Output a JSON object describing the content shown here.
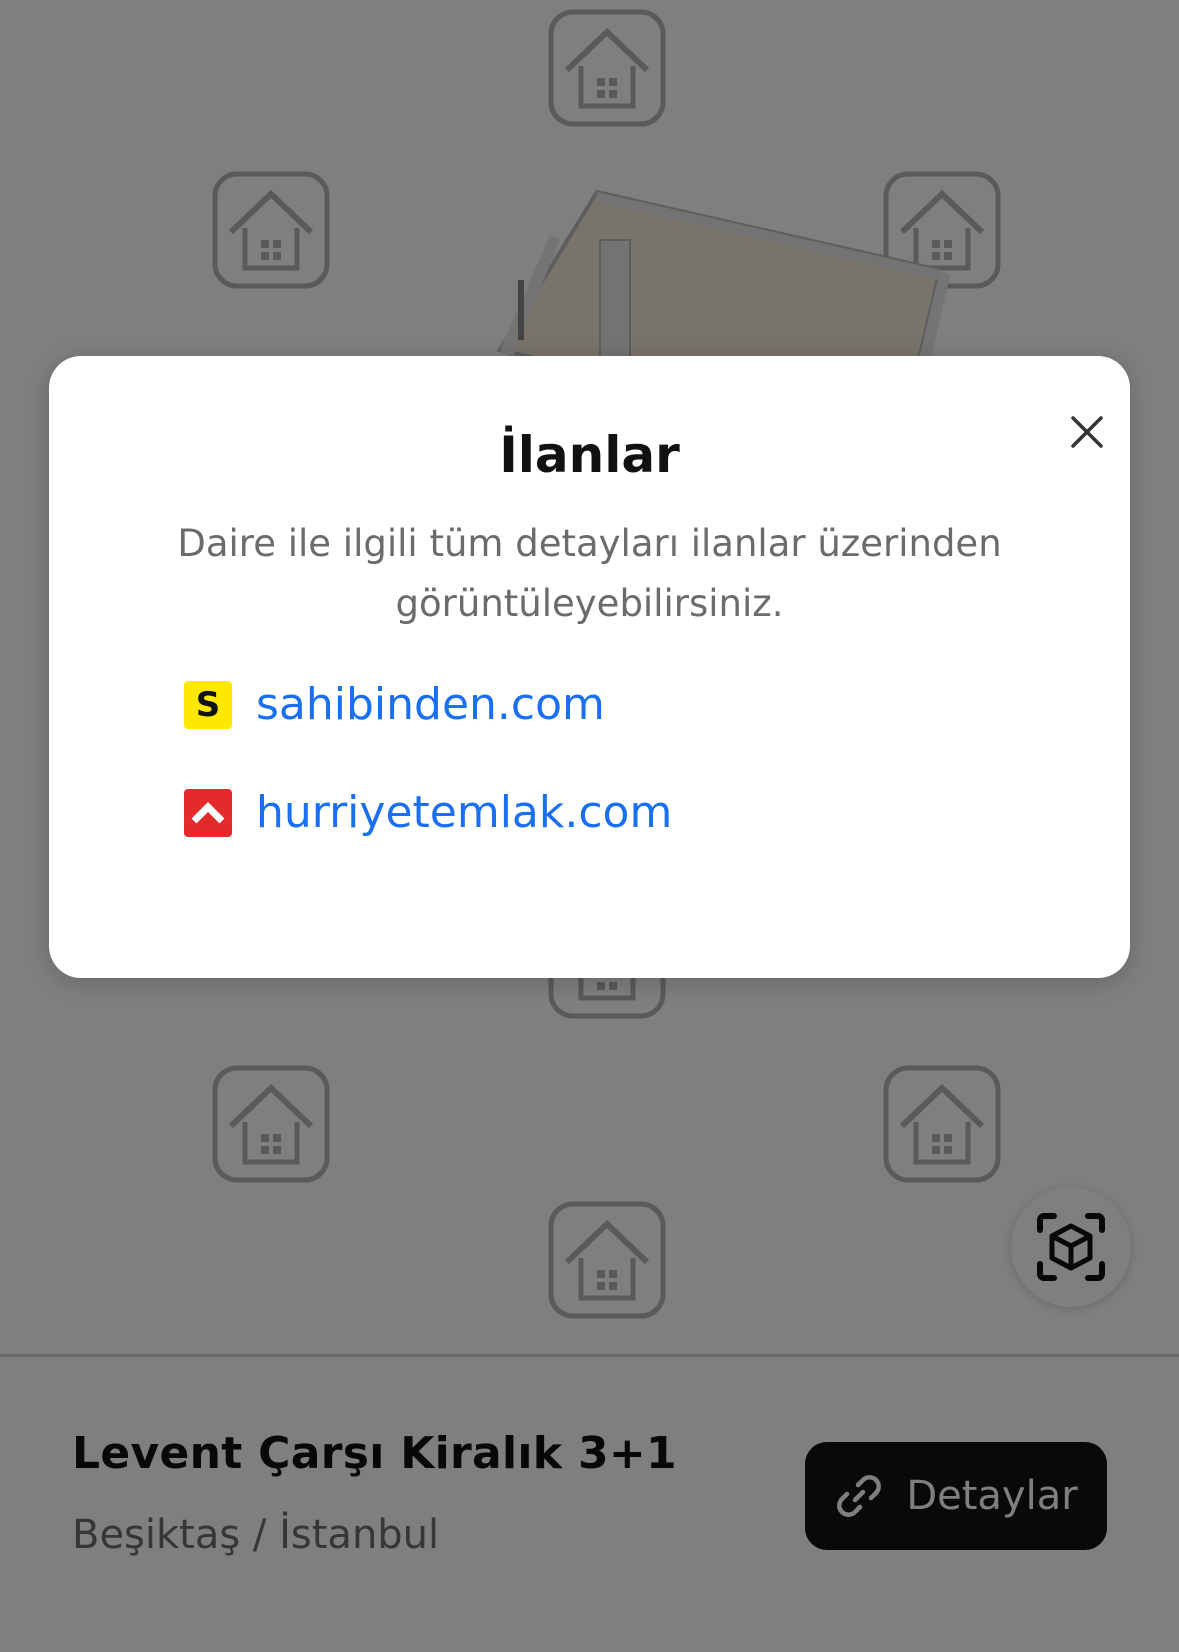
{
  "listing": {
    "title": "Levent Çarşı Kiralık 3+1",
    "location": "Beşiktaş / İstanbul",
    "details_button_label": "Detaylar"
  },
  "modal": {
    "title": "İlanlar",
    "subtitle": "Daire ile ilgili tüm detayları ilanlar üzerinden görüntüleyebilirsiniz.",
    "links": [
      {
        "label": "sahibinden.com",
        "logo_letter": "S",
        "logo_color": "#ffe800"
      },
      {
        "label": "hurriyetemlak.com",
        "logo_color": "#e32b2b"
      }
    ]
  },
  "icons": {
    "close": "close-icon",
    "ar": "ar-cube-icon",
    "link": "link-icon",
    "watermark": "house-icon"
  },
  "colors": {
    "link": "#1a6ff2",
    "button_bg": "#121212",
    "overlay": "rgba(0,0,0,0.5)"
  }
}
